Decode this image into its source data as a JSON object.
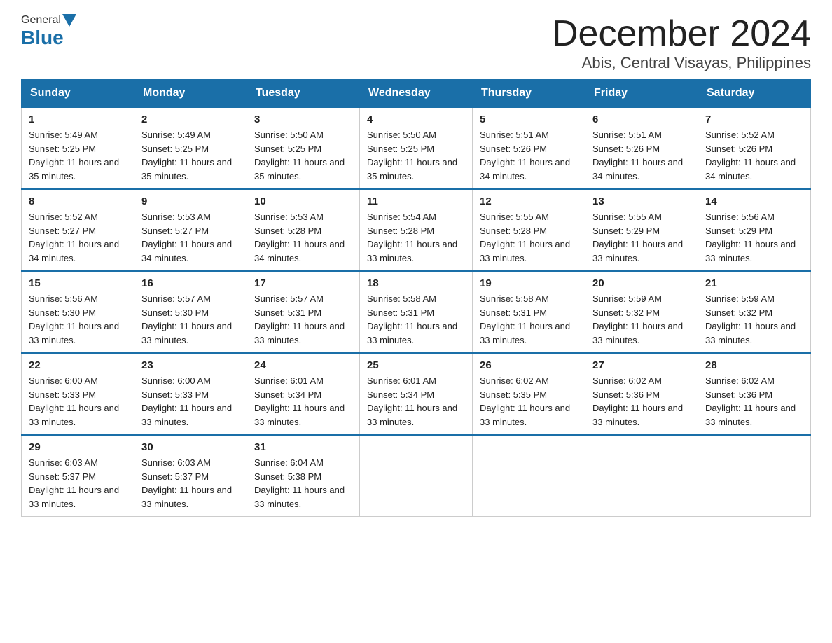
{
  "header": {
    "logo": {
      "general": "General",
      "blue": "Blue"
    },
    "title": "December 2024",
    "location": "Abis, Central Visayas, Philippines"
  },
  "days_header": [
    "Sunday",
    "Monday",
    "Tuesday",
    "Wednesday",
    "Thursday",
    "Friday",
    "Saturday"
  ],
  "weeks": [
    [
      {
        "day": "1",
        "sunrise": "5:49 AM",
        "sunset": "5:25 PM",
        "daylight": "11 hours and 35 minutes."
      },
      {
        "day": "2",
        "sunrise": "5:49 AM",
        "sunset": "5:25 PM",
        "daylight": "11 hours and 35 minutes."
      },
      {
        "day": "3",
        "sunrise": "5:50 AM",
        "sunset": "5:25 PM",
        "daylight": "11 hours and 35 minutes."
      },
      {
        "day": "4",
        "sunrise": "5:50 AM",
        "sunset": "5:25 PM",
        "daylight": "11 hours and 35 minutes."
      },
      {
        "day": "5",
        "sunrise": "5:51 AM",
        "sunset": "5:26 PM",
        "daylight": "11 hours and 34 minutes."
      },
      {
        "day": "6",
        "sunrise": "5:51 AM",
        "sunset": "5:26 PM",
        "daylight": "11 hours and 34 minutes."
      },
      {
        "day": "7",
        "sunrise": "5:52 AM",
        "sunset": "5:26 PM",
        "daylight": "11 hours and 34 minutes."
      }
    ],
    [
      {
        "day": "8",
        "sunrise": "5:52 AM",
        "sunset": "5:27 PM",
        "daylight": "11 hours and 34 minutes."
      },
      {
        "day": "9",
        "sunrise": "5:53 AM",
        "sunset": "5:27 PM",
        "daylight": "11 hours and 34 minutes."
      },
      {
        "day": "10",
        "sunrise": "5:53 AM",
        "sunset": "5:28 PM",
        "daylight": "11 hours and 34 minutes."
      },
      {
        "day": "11",
        "sunrise": "5:54 AM",
        "sunset": "5:28 PM",
        "daylight": "11 hours and 33 minutes."
      },
      {
        "day": "12",
        "sunrise": "5:55 AM",
        "sunset": "5:28 PM",
        "daylight": "11 hours and 33 minutes."
      },
      {
        "day": "13",
        "sunrise": "5:55 AM",
        "sunset": "5:29 PM",
        "daylight": "11 hours and 33 minutes."
      },
      {
        "day": "14",
        "sunrise": "5:56 AM",
        "sunset": "5:29 PM",
        "daylight": "11 hours and 33 minutes."
      }
    ],
    [
      {
        "day": "15",
        "sunrise": "5:56 AM",
        "sunset": "5:30 PM",
        "daylight": "11 hours and 33 minutes."
      },
      {
        "day": "16",
        "sunrise": "5:57 AM",
        "sunset": "5:30 PM",
        "daylight": "11 hours and 33 minutes."
      },
      {
        "day": "17",
        "sunrise": "5:57 AM",
        "sunset": "5:31 PM",
        "daylight": "11 hours and 33 minutes."
      },
      {
        "day": "18",
        "sunrise": "5:58 AM",
        "sunset": "5:31 PM",
        "daylight": "11 hours and 33 minutes."
      },
      {
        "day": "19",
        "sunrise": "5:58 AM",
        "sunset": "5:31 PM",
        "daylight": "11 hours and 33 minutes."
      },
      {
        "day": "20",
        "sunrise": "5:59 AM",
        "sunset": "5:32 PM",
        "daylight": "11 hours and 33 minutes."
      },
      {
        "day": "21",
        "sunrise": "5:59 AM",
        "sunset": "5:32 PM",
        "daylight": "11 hours and 33 minutes."
      }
    ],
    [
      {
        "day": "22",
        "sunrise": "6:00 AM",
        "sunset": "5:33 PM",
        "daylight": "11 hours and 33 minutes."
      },
      {
        "day": "23",
        "sunrise": "6:00 AM",
        "sunset": "5:33 PM",
        "daylight": "11 hours and 33 minutes."
      },
      {
        "day": "24",
        "sunrise": "6:01 AM",
        "sunset": "5:34 PM",
        "daylight": "11 hours and 33 minutes."
      },
      {
        "day": "25",
        "sunrise": "6:01 AM",
        "sunset": "5:34 PM",
        "daylight": "11 hours and 33 minutes."
      },
      {
        "day": "26",
        "sunrise": "6:02 AM",
        "sunset": "5:35 PM",
        "daylight": "11 hours and 33 minutes."
      },
      {
        "day": "27",
        "sunrise": "6:02 AM",
        "sunset": "5:36 PM",
        "daylight": "11 hours and 33 minutes."
      },
      {
        "day": "28",
        "sunrise": "6:02 AM",
        "sunset": "5:36 PM",
        "daylight": "11 hours and 33 minutes."
      }
    ],
    [
      {
        "day": "29",
        "sunrise": "6:03 AM",
        "sunset": "5:37 PM",
        "daylight": "11 hours and 33 minutes."
      },
      {
        "day": "30",
        "sunrise": "6:03 AM",
        "sunset": "5:37 PM",
        "daylight": "11 hours and 33 minutes."
      },
      {
        "day": "31",
        "sunrise": "6:04 AM",
        "sunset": "5:38 PM",
        "daylight": "11 hours and 33 minutes."
      },
      null,
      null,
      null,
      null
    ]
  ],
  "labels": {
    "sunrise": "Sunrise:",
    "sunset": "Sunset:",
    "daylight": "Daylight:"
  }
}
